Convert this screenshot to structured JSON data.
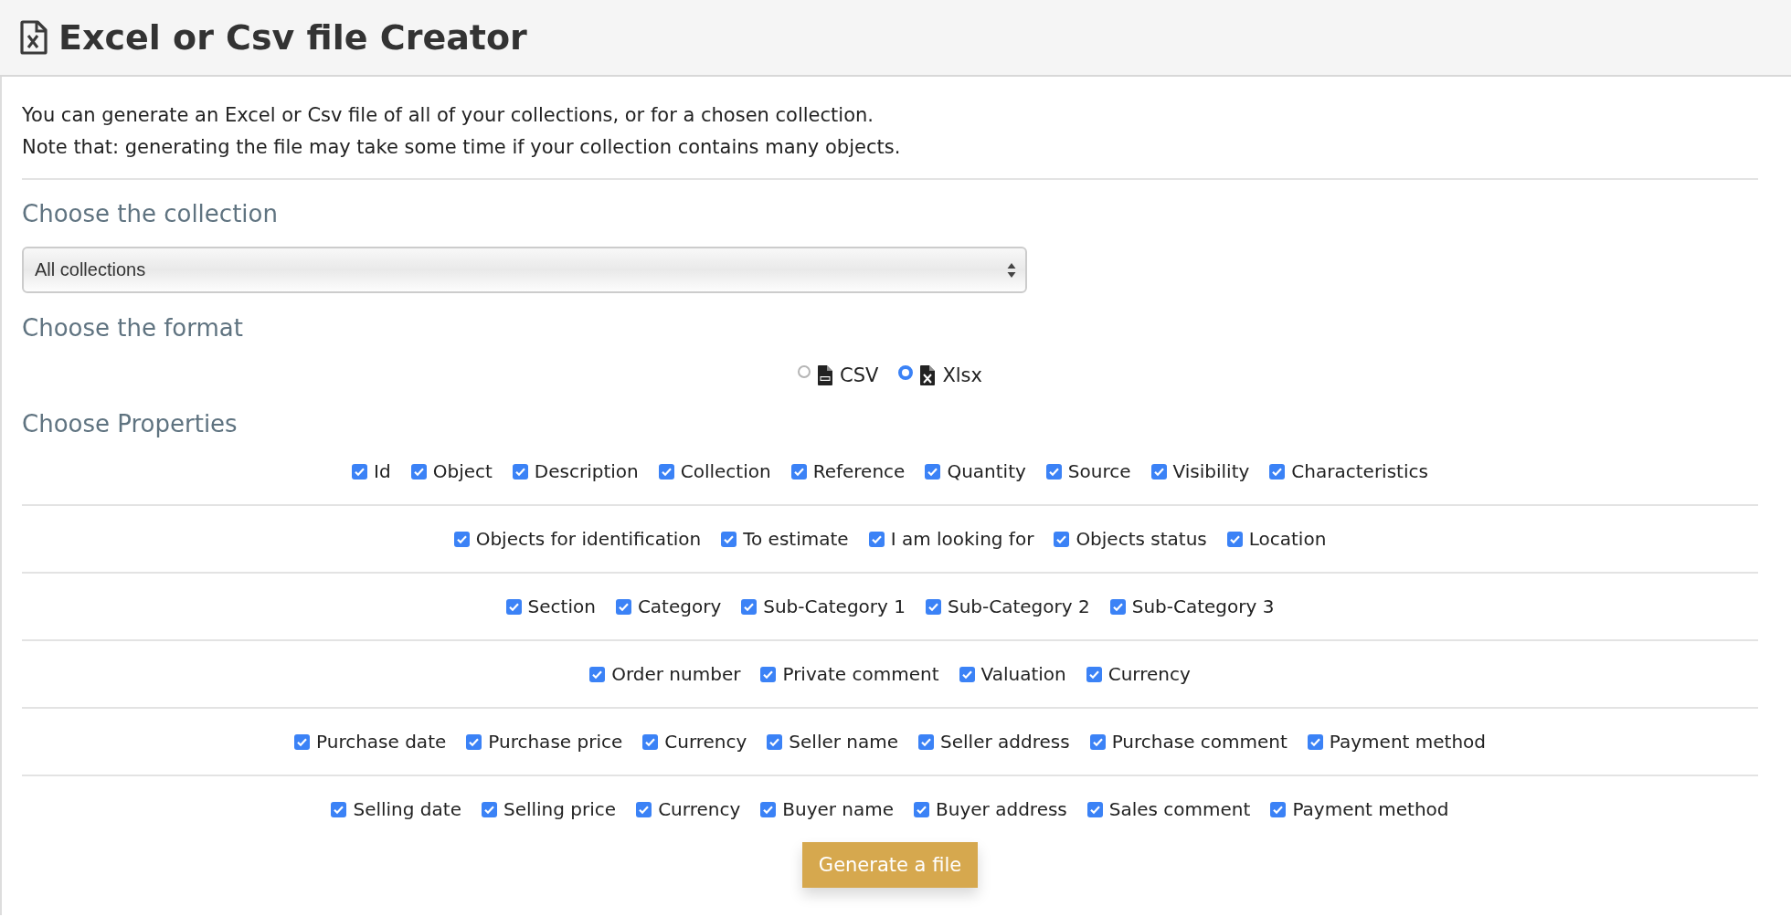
{
  "header": {
    "title": "Excel or Csv file Creator"
  },
  "intro": [
    "You can generate an Excel or Csv file of all of your collections, or for a chosen collection.",
    "Note that: generating the file may take some time if your collection contains many objects."
  ],
  "collection": {
    "heading": "Choose the collection",
    "value": "All collections"
  },
  "format": {
    "heading": "Choose the format",
    "options": [
      {
        "label": "CSV",
        "kind": "csv",
        "selected": false
      },
      {
        "label": "Xlsx",
        "kind": "xlsx",
        "selected": true
      }
    ]
  },
  "properties": {
    "heading": "Choose Properties",
    "rows": [
      [
        {
          "label": "Id",
          "checked": true
        },
        {
          "label": "Object",
          "checked": true
        },
        {
          "label": "Description",
          "checked": true
        },
        {
          "label": "Collection",
          "checked": true
        },
        {
          "label": "Reference",
          "checked": true
        },
        {
          "label": "Quantity",
          "checked": true
        },
        {
          "label": "Source",
          "checked": true
        },
        {
          "label": "Visibility",
          "checked": true
        },
        {
          "label": "Characteristics",
          "checked": true
        }
      ],
      [
        {
          "label": "Objects for identification",
          "checked": true
        },
        {
          "label": "To estimate",
          "checked": true
        },
        {
          "label": "I am looking for",
          "checked": true
        },
        {
          "label": "Objects status",
          "checked": true
        },
        {
          "label": "Location",
          "checked": true
        }
      ],
      [
        {
          "label": "Section",
          "checked": true
        },
        {
          "label": "Category",
          "checked": true
        },
        {
          "label": "Sub-Category 1",
          "checked": true
        },
        {
          "label": "Sub-Category 2",
          "checked": true
        },
        {
          "label": "Sub-Category 3",
          "checked": true
        }
      ],
      [
        {
          "label": "Order number",
          "checked": true
        },
        {
          "label": "Private comment",
          "checked": true
        },
        {
          "label": "Valuation",
          "checked": true
        },
        {
          "label": "Currency",
          "checked": true
        }
      ],
      [
        {
          "label": "Purchase date",
          "checked": true
        },
        {
          "label": "Purchase price",
          "checked": true
        },
        {
          "label": "Currency",
          "checked": true
        },
        {
          "label": "Seller name",
          "checked": true
        },
        {
          "label": "Seller address",
          "checked": true
        },
        {
          "label": "Purchase comment",
          "checked": true
        },
        {
          "label": "Payment method",
          "checked": true
        }
      ],
      [
        {
          "label": "Selling date",
          "checked": true
        },
        {
          "label": "Selling price",
          "checked": true
        },
        {
          "label": "Currency",
          "checked": true
        },
        {
          "label": "Buyer name",
          "checked": true
        },
        {
          "label": "Buyer address",
          "checked": true
        },
        {
          "label": "Sales comment",
          "checked": true
        },
        {
          "label": "Payment method",
          "checked": true
        }
      ]
    ]
  },
  "button": "Generate a file"
}
